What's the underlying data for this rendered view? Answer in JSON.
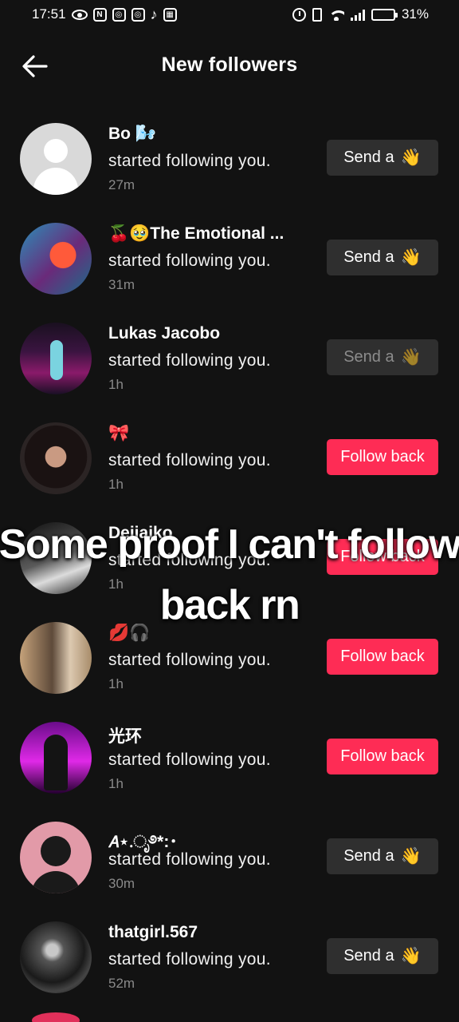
{
  "status_bar": {
    "time": "17:51",
    "battery": "31%",
    "battery_level": 0.31
  },
  "header": {
    "title": "New followers",
    "back_icon": "arrow-left-icon"
  },
  "followers": [
    {
      "name": "Bo 🌬️",
      "activity": "started following you.",
      "time": "27m",
      "button": "Send a",
      "button_type": "send",
      "avatar": "default"
    },
    {
      "name": "🍒🥹The Emotional ...",
      "activity": "started following you.",
      "time": "31m",
      "button": "Send a",
      "button_type": "send",
      "avatar": "photo"
    },
    {
      "name": "Lukas Jacobo",
      "activity": "started following you.",
      "time": "1h",
      "button": "Send a",
      "button_type": "send-dim",
      "avatar": "photo"
    },
    {
      "name": "🎀",
      "activity": "started following you.",
      "time": "1h",
      "button": "Follow back",
      "button_type": "follow",
      "avatar": "photo"
    },
    {
      "name": "Deijaiko",
      "activity": "started following you.",
      "time": "1h",
      "button": "Follow back",
      "button_type": "follow",
      "avatar": "photo"
    },
    {
      "name": "💋🎧",
      "activity": "started following you.",
      "time": "1h",
      "button": "Follow back",
      "button_type": "follow",
      "avatar": "photo"
    },
    {
      "name": "光环",
      "activity": "started following you.",
      "time": "1h",
      "button": "Follow back",
      "button_type": "follow",
      "avatar": "photo"
    },
    {
      "name": "𝘈⋆.ೃ࿔*:･",
      "activity": "started following you.",
      "time": "30m",
      "button": "Send a",
      "button_type": "send",
      "avatar": "default"
    },
    {
      "name": "thatgirl.567",
      "activity": "started following you.",
      "time": "52m",
      "button": "Send a",
      "button_type": "send",
      "avatar": "photo"
    }
  ],
  "wave_emoji": "👋",
  "overlay_caption": {
    "line1": "Some proof I can't follow",
    "line2": "back rn"
  },
  "colors": {
    "background": "#121212",
    "follow_button": "#fe2c55",
    "send_button": "#2f2f2f"
  }
}
